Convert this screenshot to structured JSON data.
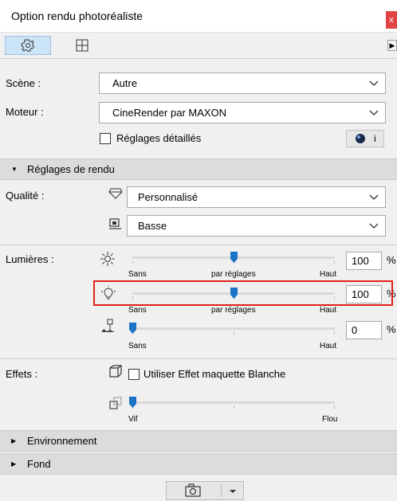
{
  "window": {
    "title": "Option rendu photoréaliste",
    "close_glyph": "x"
  },
  "tabs": {
    "settings_icon": "gear-icon",
    "layout_icon": "layout-grid-icon",
    "scroll_glyph": "▶"
  },
  "scene": {
    "label": "Scène :",
    "value": "Autre"
  },
  "engine": {
    "label": "Moteur :",
    "value": "CineRender par MAXON"
  },
  "detailed": {
    "label": "Réglages détaillés",
    "checked": false,
    "info_glyph": "i"
  },
  "render_settings": {
    "label": "Réglages de rendu",
    "expanded": true
  },
  "quality": {
    "label": "Qualité :",
    "preset": "Personnalisé",
    "level": "Basse"
  },
  "lights": {
    "label": "Lumières :",
    "sliders": [
      {
        "icon": "sun-icon",
        "value": "100",
        "unit": "%",
        "level": 0.5,
        "left": "Sans",
        "middle": "par réglages",
        "right": "Haut"
      },
      {
        "icon": "lightbulb-icon",
        "value": "100",
        "unit": "%",
        "level": 0.5,
        "left": "Sans",
        "middle": "par réglages",
        "right": "Haut"
      },
      {
        "icon": "lamp-icon",
        "value": "0",
        "unit": "%",
        "level": 0.0,
        "left": "Sans",
        "right": "Haut"
      }
    ]
  },
  "effects": {
    "label": "Effets :",
    "white_model": {
      "label": "Utiliser Effet maquette Blanche",
      "checked": false
    },
    "blur": {
      "level": 0.0,
      "left": "Vif",
      "right": "Flou"
    }
  },
  "sections": [
    {
      "label": "Environnement",
      "expanded": false
    },
    {
      "label": "Fond",
      "expanded": false
    }
  ],
  "colors": {
    "accent": "#1a73c7",
    "highlight": "#e2211c",
    "section_bg": "#dcdcdc"
  }
}
